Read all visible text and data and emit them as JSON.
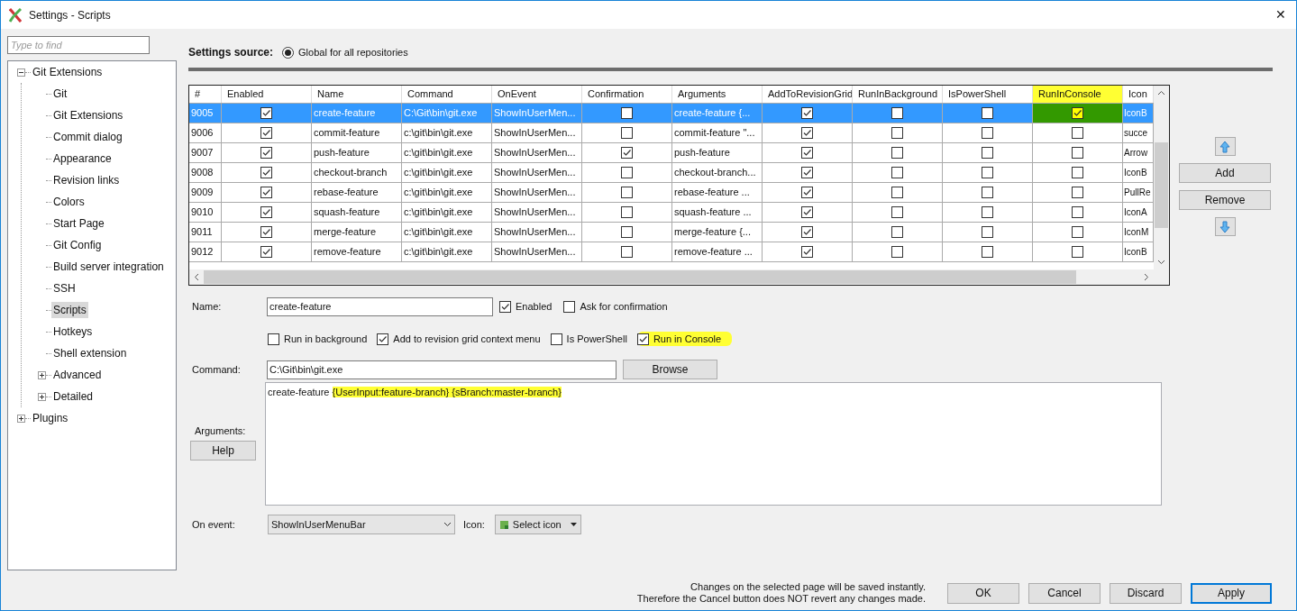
{
  "window": {
    "title": "Settings - Scripts",
    "close": "✕"
  },
  "sidebar": {
    "search_placeholder": "Type to find",
    "tree": [
      {
        "label": "Git Extensions",
        "expanded": true,
        "selected": false,
        "children": [
          {
            "label": "Git",
            "selected": false
          },
          {
            "label": "Git Extensions",
            "selected": false
          },
          {
            "label": "Commit dialog",
            "selected": false
          },
          {
            "label": "Appearance",
            "selected": false
          },
          {
            "label": "Revision links",
            "selected": false
          },
          {
            "label": "Colors",
            "selected": false
          },
          {
            "label": "Start Page",
            "selected": false
          },
          {
            "label": "Git Config",
            "selected": false
          },
          {
            "label": "Build server integration",
            "selected": false
          },
          {
            "label": "SSH",
            "selected": false
          },
          {
            "label": "Scripts",
            "selected": true
          },
          {
            "label": "Hotkeys",
            "selected": false
          },
          {
            "label": "Shell extension",
            "selected": false
          },
          {
            "label": "Advanced",
            "selected": false,
            "expanded": false
          },
          {
            "label": "Detailed",
            "selected": false,
            "expanded": false
          }
        ]
      },
      {
        "label": "Plugins",
        "expanded": false,
        "selected": false
      }
    ]
  },
  "settings_source": {
    "label": "Settings source:",
    "option": "Global for all repositories",
    "selected": true
  },
  "table": {
    "columns": [
      {
        "label": "#",
        "highlighted": false
      },
      {
        "label": "Enabled",
        "highlighted": false
      },
      {
        "label": "Name",
        "highlighted": false
      },
      {
        "label": "Command",
        "highlighted": false
      },
      {
        "label": "OnEvent",
        "highlighted": false
      },
      {
        "label": "Confirmation",
        "highlighted": false
      },
      {
        "label": "Arguments",
        "highlighted": false
      },
      {
        "label": "AddToRevisionGrid",
        "highlighted": false
      },
      {
        "label": "RunInBackground",
        "highlighted": false
      },
      {
        "label": "IsPowerShell",
        "highlighted": false
      },
      {
        "label": "RunInConsole",
        "highlighted": true
      },
      {
        "label": "Icon",
        "highlighted": false
      }
    ],
    "rows": [
      {
        "id": "9005",
        "enabled": true,
        "name": "create-feature",
        "command": "C:\\Git\\bin\\git.exe",
        "on_event": "ShowInUserMen...",
        "confirmation": false,
        "arguments": "create-feature {...",
        "add_to_revision_grid": true,
        "run_in_background": false,
        "is_powershell": false,
        "run_in_console": true,
        "icon": "IconB",
        "selected": true,
        "highlighted": true
      },
      {
        "id": "9006",
        "enabled": true,
        "name": "commit-feature",
        "command": "c:\\git\\bin\\git.exe",
        "on_event": "ShowInUserMen...",
        "confirmation": false,
        "arguments": "commit-feature \"...",
        "add_to_revision_grid": true,
        "run_in_background": false,
        "is_powershell": false,
        "run_in_console": false,
        "icon": "succe",
        "selected": false,
        "highlighted": false
      },
      {
        "id": "9007",
        "enabled": true,
        "name": "push-feature",
        "command": "c:\\git\\bin\\git.exe",
        "on_event": "ShowInUserMen...",
        "confirmation": true,
        "arguments": "push-feature",
        "add_to_revision_grid": true,
        "run_in_background": false,
        "is_powershell": false,
        "run_in_console": false,
        "icon": "Arrow",
        "selected": false,
        "highlighted": false
      },
      {
        "id": "9008",
        "enabled": true,
        "name": "checkout-branch",
        "command": "c:\\git\\bin\\git.exe",
        "on_event": "ShowInUserMen...",
        "confirmation": false,
        "arguments": "checkout-branch...",
        "add_to_revision_grid": true,
        "run_in_background": false,
        "is_powershell": false,
        "run_in_console": false,
        "icon": "IconB",
        "selected": false,
        "highlighted": false
      },
      {
        "id": "9009",
        "enabled": true,
        "name": "rebase-feature",
        "command": "c:\\git\\bin\\git.exe",
        "on_event": "ShowInUserMen...",
        "confirmation": false,
        "arguments": "rebase-feature ...",
        "add_to_revision_grid": true,
        "run_in_background": false,
        "is_powershell": false,
        "run_in_console": false,
        "icon": "PullRe",
        "selected": false,
        "highlighted": false
      },
      {
        "id": "9010",
        "enabled": true,
        "name": "squash-feature",
        "command": "c:\\git\\bin\\git.exe",
        "on_event": "ShowInUserMen...",
        "confirmation": false,
        "arguments": "squash-feature ...",
        "add_to_revision_grid": true,
        "run_in_background": false,
        "is_powershell": false,
        "run_in_console": false,
        "icon": "IconA",
        "selected": false,
        "highlighted": false
      },
      {
        "id": "9011",
        "enabled": true,
        "name": "merge-feature",
        "command": "c:\\git\\bin\\git.exe",
        "on_event": "ShowInUserMen...",
        "confirmation": false,
        "arguments": "merge-feature {...",
        "add_to_revision_grid": true,
        "run_in_background": false,
        "is_powershell": false,
        "run_in_console": false,
        "icon": "IconM",
        "selected": false,
        "highlighted": false
      },
      {
        "id": "9012",
        "enabled": true,
        "name": "remove-feature",
        "command": "c:\\git\\bin\\git.exe",
        "on_event": "ShowInUserMen...",
        "confirmation": false,
        "arguments": "remove-feature ...",
        "add_to_revision_grid": true,
        "run_in_background": false,
        "is_powershell": false,
        "run_in_console": false,
        "icon": "IconB",
        "selected": false,
        "highlighted": false
      }
    ]
  },
  "side_buttons": {
    "add": "Add",
    "remove": "Remove"
  },
  "form": {
    "name_label": "Name:",
    "name_value": "create-feature",
    "options_row_1": [
      {
        "label": "Enabled",
        "checked": true,
        "highlighted": false
      },
      {
        "label": "Ask for confirmation",
        "checked": false,
        "highlighted": false
      }
    ],
    "options_row_2": [
      {
        "label": "Run in background",
        "checked": false,
        "highlighted": false
      },
      {
        "label": "Add to revision grid context menu",
        "checked": true,
        "highlighted": false
      },
      {
        "label": "Is PowerShell",
        "checked": false,
        "highlighted": false
      },
      {
        "label": "Run in Console",
        "checked": true,
        "highlighted": true
      }
    ],
    "command_label": "Command:",
    "command_value": "C:\\Git\\bin\\git.exe",
    "browse": "Browse",
    "arguments_label": "Arguments:",
    "help": "Help",
    "arguments": [
      {
        "text": "create-feature ",
        "highlighted": false
      },
      {
        "text": "{UserInput:feature-branch} {sBranch:master-branch}",
        "highlighted": true
      }
    ],
    "on_event_label": "On event:",
    "on_event_value": "ShowInUserMenuBar",
    "icon_label": "Icon:",
    "icon_button": "Select icon"
  },
  "footer": {
    "notice": [
      "Changes on the selected page will be saved instantly.",
      "Therefore the Cancel button does NOT revert any changes made."
    ],
    "buttons": [
      {
        "label": "OK",
        "default": false
      },
      {
        "label": "Cancel",
        "default": false
      },
      {
        "label": "Discard",
        "default": false
      },
      {
        "label": "Apply",
        "default": true
      }
    ]
  }
}
